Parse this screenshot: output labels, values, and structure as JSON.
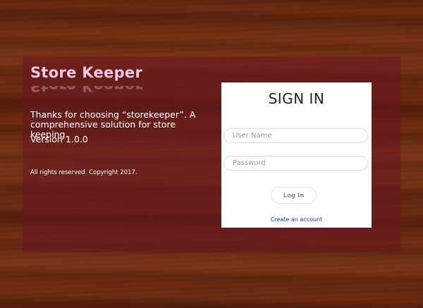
{
  "brand": {
    "title": "Store Keeper",
    "tagline": "Thanks for choosing “storekeeper”. A comprehensive solution for store keeping.",
    "version": "Version 1.0.0",
    "copyright": "All rights reserved. Copyright 2017."
  },
  "login": {
    "heading": "SIGN IN",
    "username_placeholder": "User Name",
    "username_value": "",
    "password_placeholder": "Password",
    "password_value": "",
    "submit_label": "Log In",
    "create_account_label": "Create an account"
  },
  "colors": {
    "brand_title": "#f2c7e6",
    "panel_overlay": "#69142380",
    "link": "#1a2a8a"
  }
}
